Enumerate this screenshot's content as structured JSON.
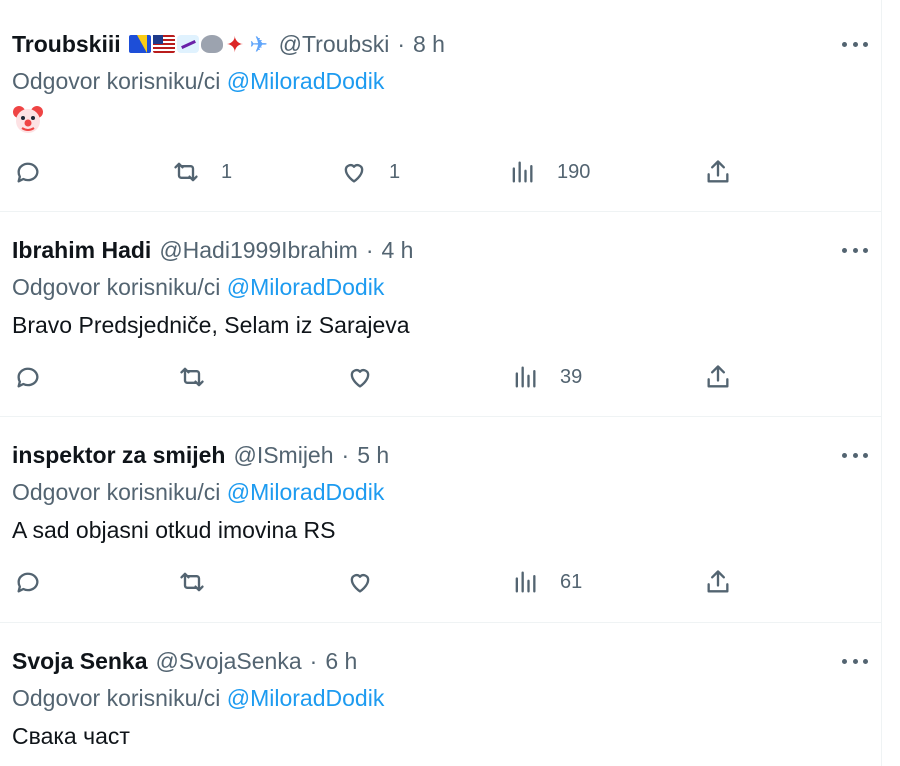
{
  "tweets": [
    {
      "name": "Troubskiii",
      "handle": "@Troubski",
      "time": "8 h",
      "reply_prefix": "Odgovor korisniku/ci",
      "reply_to": "@MiloradDodik",
      "body": "",
      "body_emoji": "clown-face",
      "name_emojis": [
        "flag-bosnia",
        "flag-usa",
        "snowboarder",
        "wolf",
        "maple-leaf",
        "airplane"
      ],
      "retweets": "1",
      "likes": "1",
      "views": "190"
    },
    {
      "name": "Ibrahim Hadi",
      "handle": "@Hadi1999Ibrahim",
      "time": "4 h",
      "reply_prefix": "Odgovor korisniku/ci",
      "reply_to": "@MiloradDodik",
      "body": "Bravo Predsjedniče, Selam iz Sarajeva",
      "retweets": "",
      "likes": "",
      "views": "39"
    },
    {
      "name": "inspektor za smijeh",
      "handle": "@ISmijeh",
      "time": "5 h",
      "reply_prefix": "Odgovor korisniku/ci",
      "reply_to": "@MiloradDodik",
      "body": "A sad objasni otkud imovina RS",
      "retweets": "",
      "likes": "",
      "views": "61"
    },
    {
      "name": "Svoja Senka",
      "handle": "@SvojaSenka",
      "time": "6 h",
      "reply_prefix": "Odgovor korisniku/ci",
      "reply_to": "@MiloradDodik",
      "body": "Свака част"
    }
  ],
  "meta_separator": "·",
  "colors": {
    "text_primary": "#0f1419",
    "text_secondary": "#536471",
    "link": "#1d9bf0",
    "divider": "#eff3f4"
  }
}
